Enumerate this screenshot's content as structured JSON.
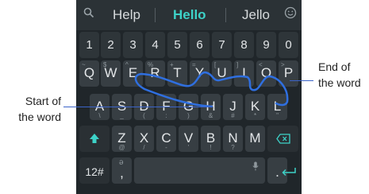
{
  "suggestions": {
    "search_icon": "search-icon",
    "left": "Help",
    "center": "Hello",
    "right": "Jello",
    "emoji_icon": "emoji-icon"
  },
  "rows": {
    "numbers": [
      "1",
      "2",
      "3",
      "4",
      "5",
      "6",
      "7",
      "8",
      "9",
      "0"
    ],
    "top": [
      {
        "key": "Q",
        "sub": "~"
      },
      {
        "key": "W",
        "sub": "$"
      },
      {
        "key": "E",
        "sub": "^"
      },
      {
        "key": "R",
        "sub": "%"
      },
      {
        "key": "T",
        "sub": "+"
      },
      {
        "key": "Y",
        "sub": "="
      },
      {
        "key": "U",
        "sub": "["
      },
      {
        "key": "I",
        "sub": "]"
      },
      {
        "key": "O",
        "sub": "<"
      },
      {
        "key": "P",
        "sub": ">"
      }
    ],
    "home": [
      {
        "key": "A",
        "sub": "\\"
      },
      {
        "key": "S",
        "sub": "_"
      },
      {
        "key": "D",
        "sub": "("
      },
      {
        "key": "F",
        "sub": ":"
      },
      {
        "key": "G",
        "sub": ")"
      },
      {
        "key": "H",
        "sub": "&"
      },
      {
        "key": "J",
        "sub": "#"
      },
      {
        "key": "K",
        "sub": "*"
      },
      {
        "key": "L",
        "sub": "\""
      }
    ],
    "bottom": [
      {
        "key": "Z",
        "sub": "@"
      },
      {
        "key": "X",
        "sub": "/"
      },
      {
        "key": "C",
        "sub": "-"
      },
      {
        "key": "V",
        "sub": "'"
      },
      {
        "key": "B",
        "sub": "!"
      },
      {
        "key": "N",
        "sub": "?"
      },
      {
        "key": "M",
        "sub": ""
      }
    ]
  },
  "function_keys": {
    "shift_icon": "shift-up-arrow-icon",
    "backspace_icon": "backspace-icon",
    "symbols_label": "12#",
    "comma_label": ",",
    "comma_sub": "ə",
    "mic_icon": "microphone-icon",
    "period_label": ".",
    "enter_icon": "enter-return-icon"
  },
  "annotations": {
    "end_line1": "End of",
    "end_line2": "the word",
    "start_line1": "Start of",
    "start_line2": "the word"
  },
  "colors": {
    "keyboard_bg": "#20262a",
    "key_bg": "#373e43",
    "accent": "#3dd2c8",
    "swipe_path": "#2f6fe0"
  }
}
